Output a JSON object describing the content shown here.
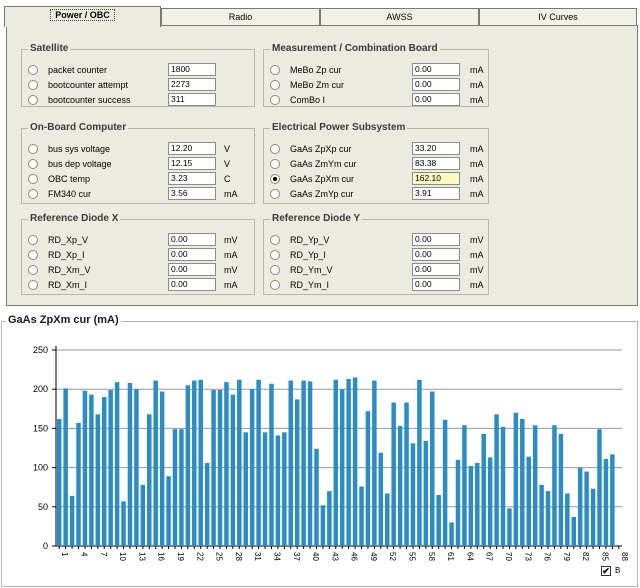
{
  "tabs": [
    {
      "label": "Power / OBC",
      "active": true
    },
    {
      "label": "Radio",
      "active": false
    },
    {
      "label": "AWSS",
      "active": false
    },
    {
      "label": "IV Curves",
      "active": false
    }
  ],
  "groups": {
    "satellite": {
      "title": "Satellite",
      "rows": [
        {
          "label": "packet counter",
          "value": "1800",
          "unit": "",
          "selected": false,
          "highlight": false
        },
        {
          "label": "bootcounter attempt",
          "value": "2273",
          "unit": "",
          "selected": false,
          "highlight": false
        },
        {
          "label": "bootcounter success",
          "value": "311",
          "unit": "",
          "selected": false,
          "highlight": false
        }
      ]
    },
    "mebo": {
      "title": "Measurement / Combination Board",
      "rows": [
        {
          "label": "MeBo Zp cur",
          "value": "0.00",
          "unit": "mA",
          "selected": false,
          "highlight": false
        },
        {
          "label": "MeBo Zm cur",
          "value": "0.00",
          "unit": "mA",
          "selected": false,
          "highlight": false
        },
        {
          "label": "ComBo I",
          "value": "0.00",
          "unit": "mA",
          "selected": false,
          "highlight": false
        }
      ]
    },
    "obc": {
      "title": "On-Board Computer",
      "rows": [
        {
          "label": "bus sys voltage",
          "value": "12.20",
          "unit": "V",
          "selected": false,
          "highlight": false
        },
        {
          "label": "bus dep voltage",
          "value": "12.15",
          "unit": "V",
          "selected": false,
          "highlight": false
        },
        {
          "label": "OBC temp",
          "value": "3.23",
          "unit": "C",
          "selected": false,
          "highlight": false
        },
        {
          "label": "FM340 cur",
          "value": "3.56",
          "unit": "mA",
          "selected": false,
          "highlight": false
        }
      ]
    },
    "eps": {
      "title": "Electrical Power Subsystem",
      "rows": [
        {
          "label": "GaAs ZpXp cur",
          "value": "33.20",
          "unit": "mA",
          "selected": false,
          "highlight": false
        },
        {
          "label": "GaAs ZmYm cur",
          "value": "83.38",
          "unit": "mA",
          "selected": false,
          "highlight": false
        },
        {
          "label": "GaAs ZpXm cur",
          "value": "162.10",
          "unit": "mA",
          "selected": true,
          "highlight": true
        },
        {
          "label": "GaAs ZmYp cur",
          "value": "3.91",
          "unit": "mA",
          "selected": false,
          "highlight": false
        }
      ]
    },
    "refx": {
      "title": "Reference Diode X",
      "rows": [
        {
          "label": "RD_Xp_V",
          "value": "0.00",
          "unit": "mV",
          "selected": false,
          "highlight": false
        },
        {
          "label": "RD_Xp_I",
          "value": "0.00",
          "unit": "mA",
          "selected": false,
          "highlight": false
        },
        {
          "label": "RD_Xm_V",
          "value": "0.00",
          "unit": "mV",
          "selected": false,
          "highlight": false
        },
        {
          "label": "RD_Xm_I",
          "value": "0.00",
          "unit": "mA",
          "selected": false,
          "highlight": false
        }
      ]
    },
    "refy": {
      "title": "Reference Diode Y",
      "rows": [
        {
          "label": "RD_Yp_V",
          "value": "0.00",
          "unit": "mV",
          "selected": false,
          "highlight": false
        },
        {
          "label": "RD_Yp_I",
          "value": "0.00",
          "unit": "mA",
          "selected": false,
          "highlight": false
        },
        {
          "label": "RD_Ym_V",
          "value": "0.00",
          "unit": "mV",
          "selected": false,
          "highlight": false
        },
        {
          "label": "RD_Ym_I",
          "value": "0.00",
          "unit": "mA",
          "selected": false,
          "highlight": false
        }
      ]
    }
  },
  "chart": {
    "title": "GaAs ZpXm cur (mA)",
    "legend_label": "B",
    "legend_checked": true,
    "check_glyph": "✔"
  },
  "chart_data": {
    "type": "bar",
    "title": "GaAs ZpXm cur (mA)",
    "ylim": [
      0,
      250
    ],
    "yticks": [
      0,
      50,
      100,
      150,
      200,
      250
    ],
    "grid": true,
    "bar_color": "#2e8cc3",
    "x": [
      1,
      2,
      3,
      4,
      5,
      6,
      7,
      8,
      9,
      10,
      11,
      12,
      13,
      14,
      15,
      16,
      17,
      18,
      19,
      20,
      21,
      22,
      23,
      24,
      25,
      26,
      27,
      28,
      29,
      30,
      31,
      32,
      33,
      34,
      35,
      36,
      37,
      38,
      39,
      40,
      41,
      42,
      43,
      44,
      45,
      46,
      47,
      48,
      49,
      50,
      51,
      52,
      53,
      54,
      55,
      56,
      57,
      58,
      59,
      60,
      61,
      62,
      63,
      64,
      65,
      66,
      67,
      68,
      69,
      70,
      71,
      72,
      73,
      74,
      75,
      76,
      77,
      78,
      79,
      80,
      81,
      82,
      83,
      84,
      85,
      86,
      87,
      88
    ],
    "values": [
      162,
      201,
      64,
      157,
      198,
      193,
      168,
      190,
      199,
      209,
      57,
      208,
      200,
      78,
      168,
      211,
      197,
      89,
      149,
      149,
      205,
      211,
      212,
      106,
      199,
      199,
      209,
      193,
      212,
      145,
      200,
      212,
      145,
      207,
      141,
      145,
      211,
      187,
      211,
      210,
      124,
      52,
      70,
      212,
      200,
      213,
      215,
      76,
      172,
      211,
      119,
      67,
      183,
      153,
      183,
      131,
      212,
      134,
      197,
      65,
      161,
      30,
      110,
      154,
      102,
      106,
      143,
      113,
      168,
      152,
      48,
      170,
      162,
      114,
      154,
      78,
      70,
      154,
      143,
      67,
      37,
      100,
      95,
      73,
      149,
      111,
      117,
      0
    ]
  }
}
